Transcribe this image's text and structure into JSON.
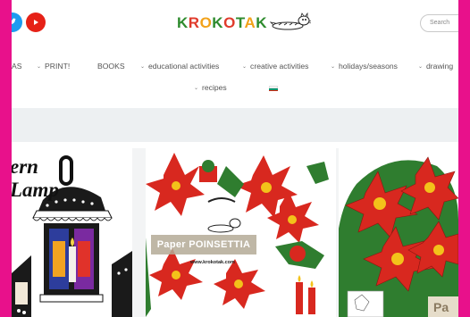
{
  "header": {
    "logo_text": "KROKOTAK",
    "search_placeholder": "Search"
  },
  "nav": {
    "items": [
      {
        "label": "AS",
        "chevron": false
      },
      {
        "label": "PRINT!",
        "chevron": true
      },
      {
        "label": "BOOKS",
        "chevron": false
      },
      {
        "label": "educational activities",
        "chevron": true
      },
      {
        "label": "creative activities",
        "chevron": true
      },
      {
        "label": "holidays/seasons",
        "chevron": true
      },
      {
        "label": "drawing",
        "chevron": true
      },
      {
        "label": "recipes",
        "chevron": true
      }
    ],
    "flag_colors": [
      "#ffffff",
      "#00966e",
      "#d62612"
    ]
  },
  "cards": [
    {
      "title": "ern\nLamp"
    },
    {
      "sign": "Paper POINSETTIA",
      "url": "www.krokotak.com"
    },
    {
      "caption": "Pa"
    }
  ],
  "colors": {
    "frame": "#e8118b",
    "band": "#edf0f2",
    "poinsettia_red": "#d8281f",
    "leaf_green": "#2f7d2f"
  }
}
